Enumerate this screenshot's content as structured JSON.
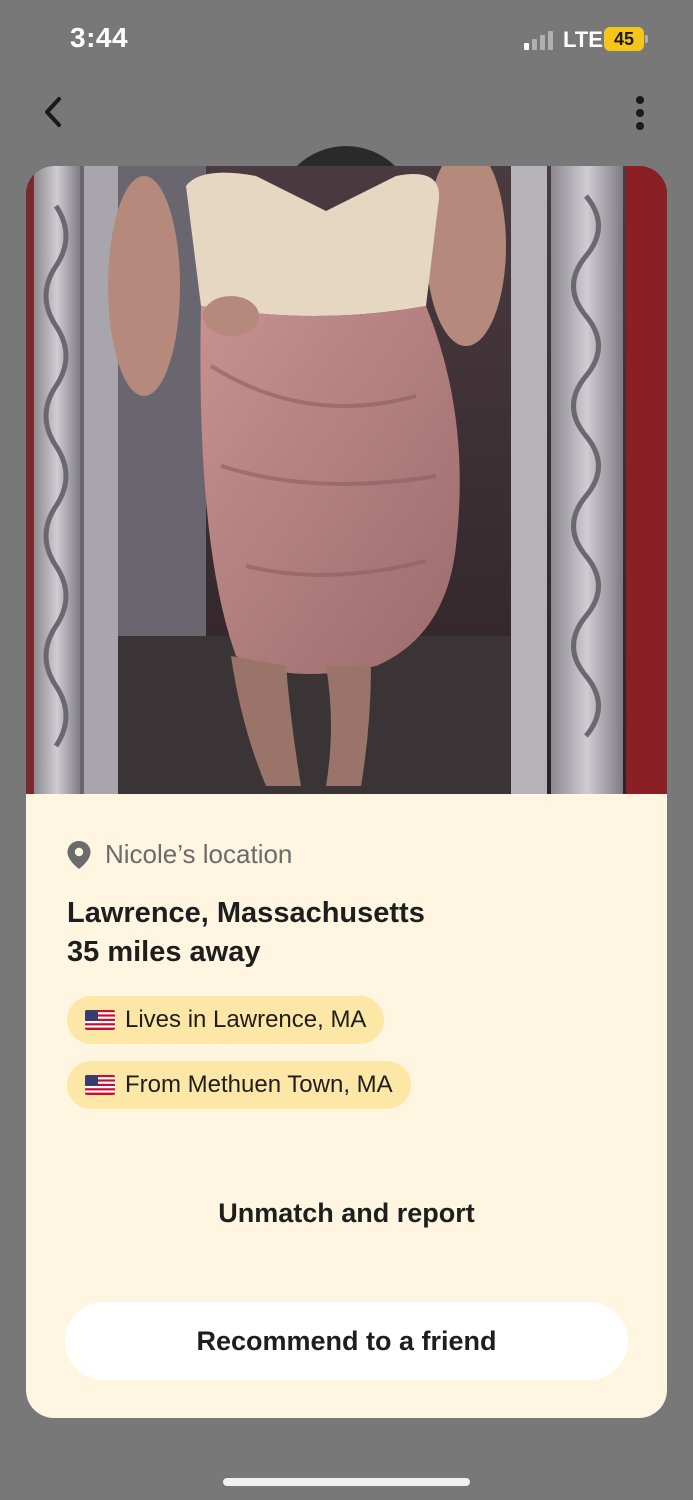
{
  "status_bar": {
    "time": "3:44",
    "network": "LTE",
    "battery": "45"
  },
  "nav": {
    "back_icon": "chevron-left-icon",
    "more_icon": "more-vertical-icon"
  },
  "profile": {
    "photo_description_icon": "profile-photo"
  },
  "location": {
    "header_icon": "location-pin-icon",
    "header": "Nicole’s location",
    "city": "Lawrence, Massachusetts",
    "distance": "35 miles away",
    "chips": [
      {
        "icon": "us-flag-icon",
        "label": "Lives in Lawrence, MA"
      },
      {
        "icon": "us-flag-icon",
        "label": "From Methuen Town, MA"
      }
    ]
  },
  "actions": {
    "unmatch_label": "Unmatch and report",
    "recommend_label": "Recommend to a friend"
  },
  "colors": {
    "background": "#787878",
    "card": "#fef6e0",
    "chip": "#fde7a6",
    "battery": "#f5c518",
    "text": "#1e1e1e",
    "muted": "#6b6b6b"
  }
}
